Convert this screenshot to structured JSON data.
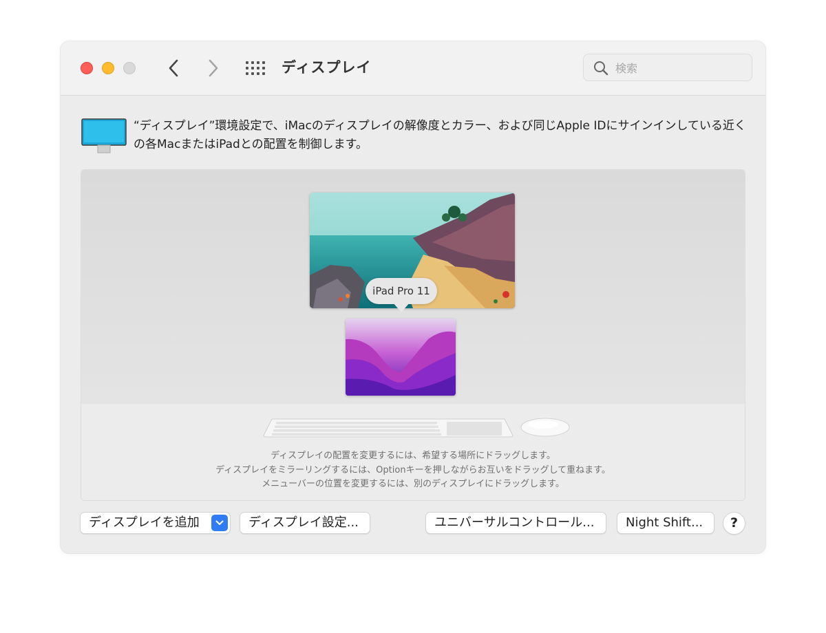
{
  "window": {
    "title": "ディスプレイ",
    "search": {
      "placeholder": "検索",
      "value": ""
    }
  },
  "description": "“ディスプレイ”環境設定で、iMacのディスプレイの解像度とカラー、および同じApple IDにサインインしている近くの各MacまたはiPadとの配置を制御します。",
  "arrangement": {
    "tooltip": "iPad Pro 11",
    "hints": [
      "ディスプレイの配置を変更するには、希望する場所にドラッグします。",
      "ディスプレイをミラーリングするには、Optionキーを押しながらお互いをドラッグして重ねます。",
      "メニューバーの位置を変更するには、別のディスプレイにドラッグします。"
    ]
  },
  "buttons": {
    "add_display": "ディスプレイを追加",
    "display_settings": "ディスプレイ設定...",
    "universal_control": "ユニバーサルコントロール...",
    "night_shift": "Night Shift...",
    "help": "?"
  },
  "colors": {
    "close": "#ff5f57",
    "minimize": "#febc2e",
    "zoom_disabled": "#d9d9d9",
    "accent": "#2f7cf6"
  },
  "icons": [
    "back-chevron-icon",
    "forward-chevron-icon",
    "show-all-grid-icon",
    "search-icon",
    "display-pref-icon",
    "chevron-down-icon",
    "keyboard-icon",
    "mouse-icon"
  ]
}
